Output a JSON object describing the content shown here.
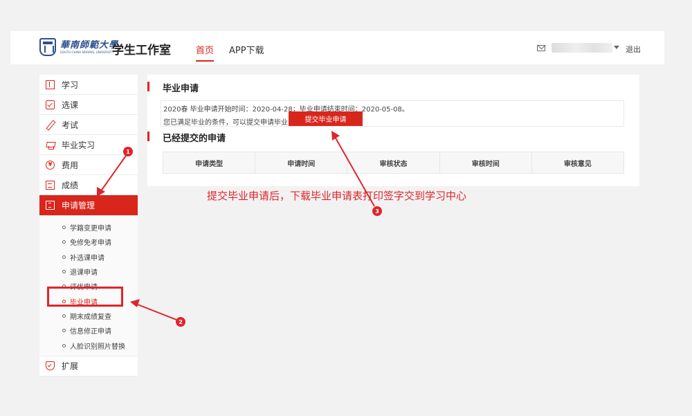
{
  "header": {
    "logo_cn": "華南師範大學",
    "logo_en": "SOUTH CHINA NORMAL UNIVERSITY",
    "site_title": "学生工作室",
    "nav": [
      "首页",
      "APP下载"
    ],
    "logout": "退出"
  },
  "sidebar": {
    "items": [
      {
        "label": "学习",
        "icon": "book-icon"
      },
      {
        "label": "选课",
        "icon": "checkbox-icon"
      },
      {
        "label": "考试",
        "icon": "pen-icon"
      },
      {
        "label": "毕业实习",
        "icon": "graduation-cap-icon"
      },
      {
        "label": "费用",
        "icon": "yen-icon"
      },
      {
        "label": "成绩",
        "icon": "grade-icon"
      },
      {
        "label": "申请管理",
        "icon": "apply-icon"
      }
    ],
    "submenu": [
      "学籍变更申请",
      "免修免考申请",
      "补选课申请",
      "退课申请",
      "评优申请",
      "毕业申请",
      "期末成绩复查",
      "信息修正申请",
      "人脸识别照片替换"
    ],
    "extra": {
      "label": "扩展",
      "icon": "shield-icon"
    }
  },
  "main": {
    "section1_title": "毕业申请",
    "info_line1": "2020春 毕业申请开始时间：2020-04-28；毕业申请结束时间：2020-05-08。",
    "info_line2": "您已满足毕业的条件，可以提交申请毕业",
    "submit_button": "提交毕业申请",
    "section2_title": "已经提交的申请",
    "table_headers": [
      "申请类型",
      "申请时间",
      "审核状态",
      "审核时间",
      "审核意见"
    ]
  },
  "annotation": {
    "note": "提交毕业申请后，下载毕业申请表打印签字交到学习中心",
    "badges": [
      "1",
      "2",
      "3"
    ],
    "color": "#e0242c"
  },
  "colors": {
    "accent": "#d9261c",
    "brand": "#2d4f8c"
  }
}
